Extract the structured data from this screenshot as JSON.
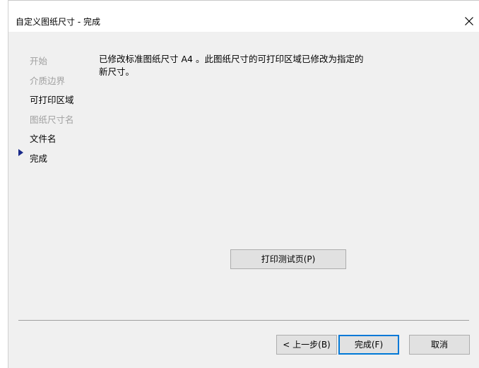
{
  "window": {
    "title": "自定义图纸尺寸 - 完成"
  },
  "steps": [
    {
      "label": "开始",
      "state": "disabled"
    },
    {
      "label": "介质边界",
      "state": "disabled"
    },
    {
      "label": "可打印区域",
      "state": "enabled"
    },
    {
      "label": "图纸尺寸名",
      "state": "disabled"
    },
    {
      "label": "文件名",
      "state": "enabled"
    },
    {
      "label": "完成",
      "state": "current"
    }
  ],
  "message": {
    "line1": "已修改标准图纸尺寸 A4 。此图纸尺寸的可打印区域已修改为指定的",
    "line2": "新尺寸。"
  },
  "buttons": {
    "print_test": "打印测试页(P)",
    "back": "< 上一步(B)",
    "finish": "完成(F)",
    "cancel": "取消"
  },
  "icons": {
    "close": "close-icon",
    "current_step": "play-arrow-icon"
  },
  "colors": {
    "focus_border": "#0078d7",
    "step_arrow": "#1a2a8a",
    "disabled_text": "#a0a0a0"
  }
}
